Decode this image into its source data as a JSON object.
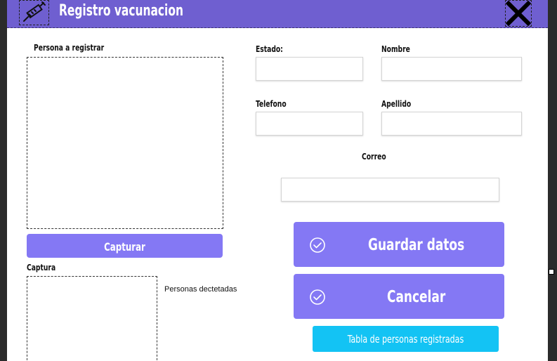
{
  "window": {
    "title": "Registro vacunacion"
  },
  "form": {
    "persona_label": "Persona a registrar",
    "captura_label": "Captura",
    "estado_label": "Estado:",
    "nombre_label": "Nombre",
    "telefono_label": "Telefono",
    "apellido_label": "Apellido",
    "correo_label": "Correo",
    "estado_value": "",
    "nombre_value": "",
    "telefono_value": "",
    "apellido_value": "",
    "correo_value": "",
    "personas_detectadas_label": "Personas dectetadas"
  },
  "buttons": {
    "capturar": "Capturar",
    "guardar": "Guardar datos",
    "cancelar": "Cancelar",
    "tabla": "Tabla de personas registradas"
  },
  "icons": {
    "logo": "syringe-icon",
    "close": "close-icon",
    "guardar": "check-circle-icon",
    "cancelar": "check-circle-icon"
  },
  "colors": {
    "titlebar": "#6f5fd0",
    "button_purple": "#8478f4",
    "button_cyan": "#13c3f4"
  }
}
